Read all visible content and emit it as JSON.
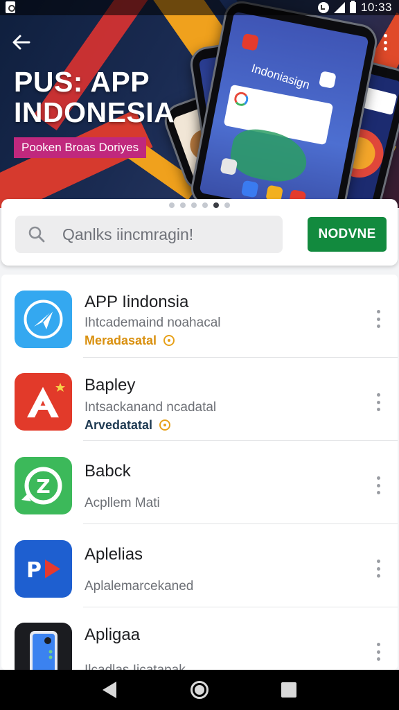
{
  "status_bar": {
    "time": "10:33"
  },
  "hero": {
    "title": "PUS: APP INDONESIA",
    "tagline": "Pooken Broas Doriyes",
    "phone_label": "Indoniasign",
    "pager": {
      "count": 6,
      "active_index": 4
    }
  },
  "search": {
    "placeholder": "Qanlks iincmragin!",
    "button_label": "NODVNE"
  },
  "apps": [
    {
      "name": "APP Iindonsia",
      "subtitle": "Ihtcademaind noahacal",
      "meta": "Meradasatal",
      "meta_color": "#d9900f",
      "icon_color": "#34a8f0",
      "icon": "paper-plane-icon"
    },
    {
      "name": "Bapley",
      "subtitle": "Intsackanand ncadatal",
      "meta": "Arvedatatal",
      "meta_color": "#1e3a52",
      "icon_color": "#e23a2a",
      "icon": "letter-a-icon"
    },
    {
      "name": "Babck",
      "subtitle": "Acpllem Mati",
      "meta": "",
      "icon_color": "#3cb95a",
      "icon": "refresh-z-icon"
    },
    {
      "name": "Aplelias",
      "subtitle": "Aplalemarcekaned",
      "meta": "",
      "icon_color": "#1e5fd0",
      "icon": "play-p-icon"
    },
    {
      "name": "Apligaa",
      "subtitle": "Ilcadlas Iicatapak",
      "meta": "",
      "icon_color": "#1b1c20",
      "icon": "phone-device-icon"
    }
  ],
  "colors": {
    "accent_green": "#128a3e",
    "tag_pink": "#c0287d",
    "banner_orange": "#f0a11d"
  }
}
